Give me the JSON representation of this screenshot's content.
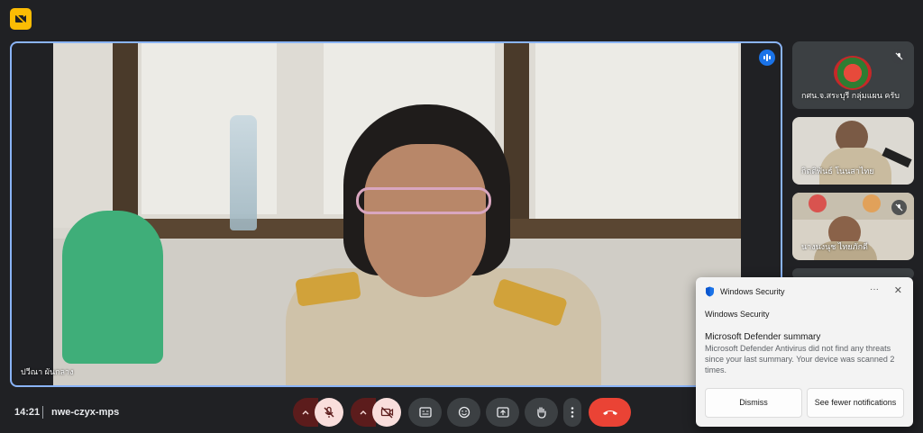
{
  "main_speaker": {
    "name": "ปวีณา ผันกลาง"
  },
  "participants": [
    {
      "name": "กศน.จ.สระบุรี กลุ่มแผน ครับ",
      "mic": "muted"
    },
    {
      "name": "กิตติพันธ์ โนนสาไทย",
      "mic": "on"
    },
    {
      "name": "นางนงนุช ไทยภักดี",
      "mic": "muted"
    }
  ],
  "footer": {
    "time": "14:21",
    "meeting_code": "nwe-czyx-mps"
  },
  "controls": {
    "mic": "mic-off-icon",
    "camera": "camera-off-icon",
    "captions": "captions-icon",
    "reactions": "emoji-icon",
    "present": "present-screen-icon",
    "raise_hand": "raise-hand-icon",
    "more": "more-options-icon",
    "end_call": "end-call-icon"
  },
  "notification": {
    "header_app": "Windows Security",
    "app_name": "Windows Security",
    "title": "Microsoft Defender summary",
    "body": "Microsoft Defender Antivirus did not find any threats since your last summary. Your device was scanned 2 times.",
    "more": "···",
    "close": "✕",
    "dismiss_label": "Dismiss",
    "see_fewer_label": "See fewer notifications"
  },
  "colors": {
    "accent": "#8ab4f8",
    "end_call": "#ea4335",
    "muted_control": "#f9dedc",
    "badge": "#fbbc04"
  }
}
